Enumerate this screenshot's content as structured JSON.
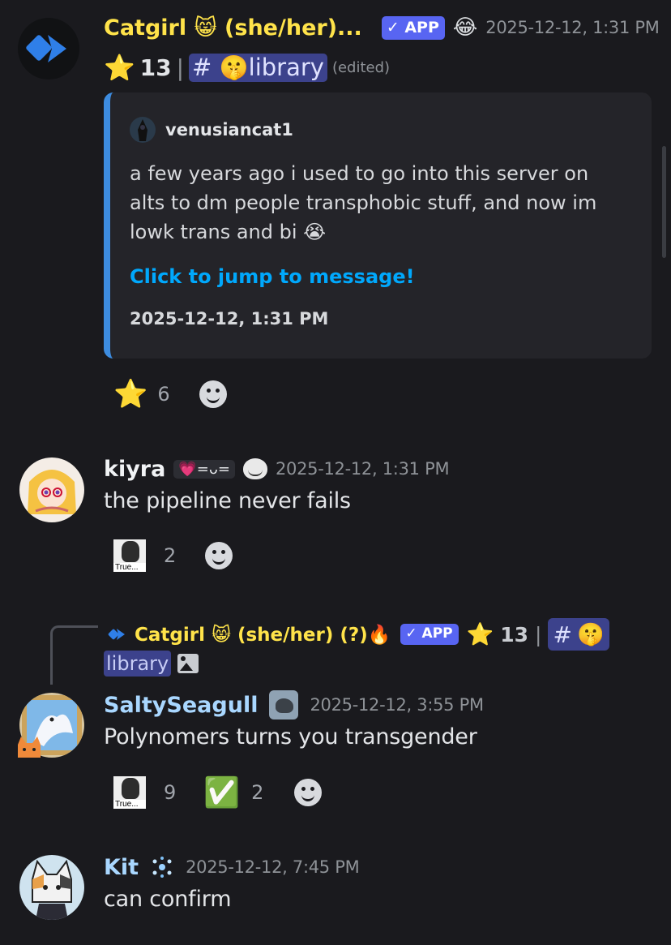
{
  "messages": [
    {
      "username": "Catgirl 😸 (she/her)...",
      "app_badge": "✓ APP",
      "decor_emoji": "😂",
      "timestamp": "2025-12-12, 1:31 PM",
      "star_count": "13",
      "channel": "# 🤫library",
      "edited": "(edited)",
      "embed": {
        "author": "venusiancat1",
        "text": "a few years ago i used to go into this server on alts to dm people transphobic stuff, and now im lowk trans and bi 😭",
        "link": "Click to jump to message!",
        "timestamp": "2025-12-12, 1:31 PM"
      },
      "reaction": {
        "emoji": "⭐",
        "count": "6"
      }
    },
    {
      "username": "kiyra",
      "tag": "💗=ᴗ=",
      "timestamp": "2025-12-12, 1:31 PM",
      "content": "the pipeline never fails",
      "reaction": {
        "label": "True...",
        "count": "2"
      }
    },
    {
      "reply": {
        "username": "Catgirl 😸 (she/her) (?)🔥",
        "app_badge": "✓ APP",
        "star_count": "13",
        "channel_hash": "#",
        "channel_emoji": "🤫",
        "channel_name": "library"
      },
      "username": "SaltySeagull",
      "timestamp": "2025-12-12, 3:55 PM",
      "content": "Polynomers turns you transgender",
      "reactions": [
        {
          "label": "True...",
          "count": "9"
        },
        {
          "emoji": "✅",
          "count": "2"
        }
      ]
    },
    {
      "username": "Kit",
      "timestamp": "2025-12-12, 7:45 PM",
      "content": "can confirm"
    }
  ],
  "icons": {
    "star": "⭐",
    "fire": "🔥",
    "image": "image-icon",
    "add_reaction": "smiley-add-reaction-icon"
  },
  "colors": {
    "background": "#1a1a1e",
    "catgirl_name": "#ffe34a",
    "kiyra_name": "#f1f3f5",
    "salty_name": "#a9d7ff",
    "kit_name": "#a9d7ff",
    "link": "#00a8fc",
    "app_badge": "#5865f2"
  }
}
